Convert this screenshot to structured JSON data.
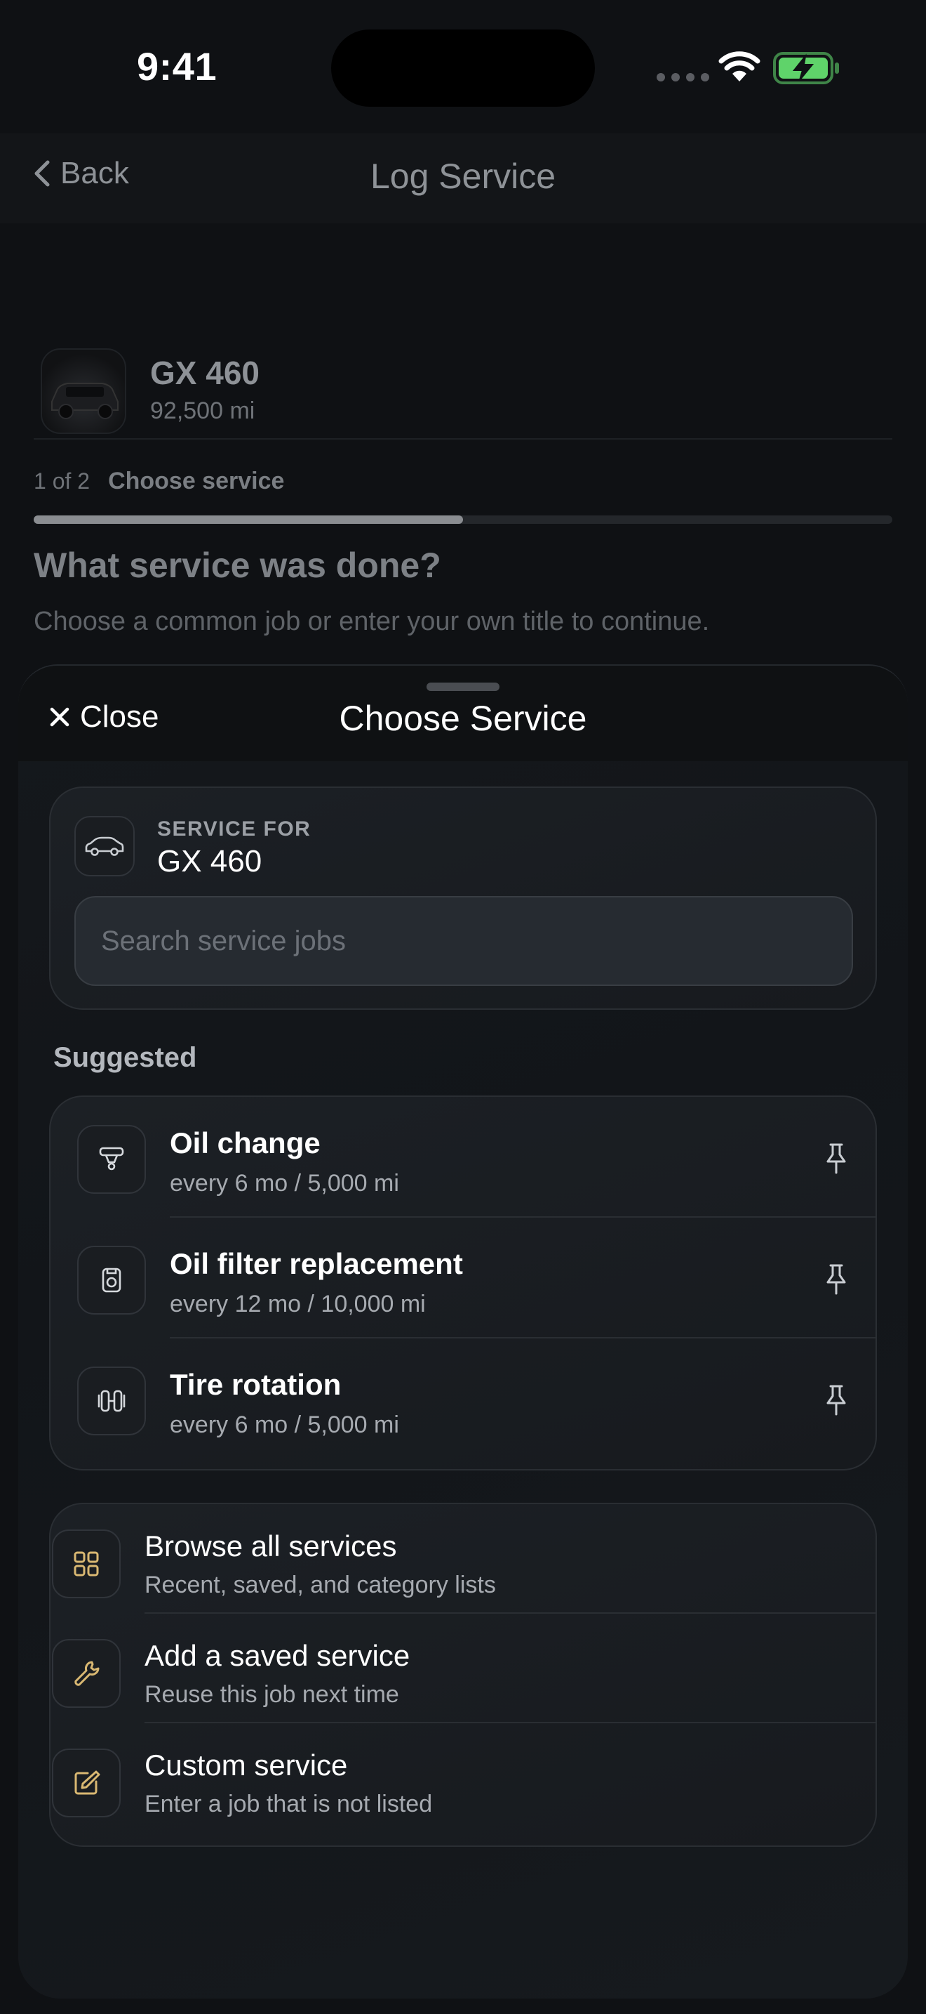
{
  "status_bar": {
    "time": "9:41"
  },
  "nav": {
    "back_label": "Back",
    "title": "Log Service"
  },
  "vehicle": {
    "name": "GX 460",
    "mileage": "92,500 mi"
  },
  "step": {
    "count": "1 of 2",
    "label": "Choose service",
    "progress": 0.5
  },
  "question": {
    "title": "What service was done?",
    "subtitle": "Choose a common job or enter your own title to continue."
  },
  "sheet": {
    "close_label": "Close",
    "title": "Choose Service",
    "service_for_label": "SERVICE FOR",
    "service_for_value": "GX 460",
    "search_placeholder": "Search service jobs",
    "suggested_label": "Suggested",
    "suggested": [
      {
        "title": "Oil change",
        "subtitle": "every 6 mo / 5,000 mi",
        "icon": "oil-change-icon"
      },
      {
        "title": "Oil filter replacement",
        "subtitle": "every 12 mo / 10,000 mi",
        "icon": "oil-filter-icon"
      },
      {
        "title": "Tire rotation",
        "subtitle": "every 6 mo / 5,000 mi",
        "icon": "tire-rotation-icon"
      }
    ],
    "actions": [
      {
        "title": "Browse all services",
        "subtitle": "Recent, saved, and category lists",
        "icon": "grid-icon"
      },
      {
        "title": "Add a saved service",
        "subtitle": "Reuse this job next time",
        "icon": "wrench-icon"
      },
      {
        "title": "Custom service",
        "subtitle": "Enter a job that is not listed",
        "icon": "edit-icon"
      }
    ]
  },
  "colors": {
    "accent": "#d9b872",
    "battery": "#5fd36a"
  }
}
